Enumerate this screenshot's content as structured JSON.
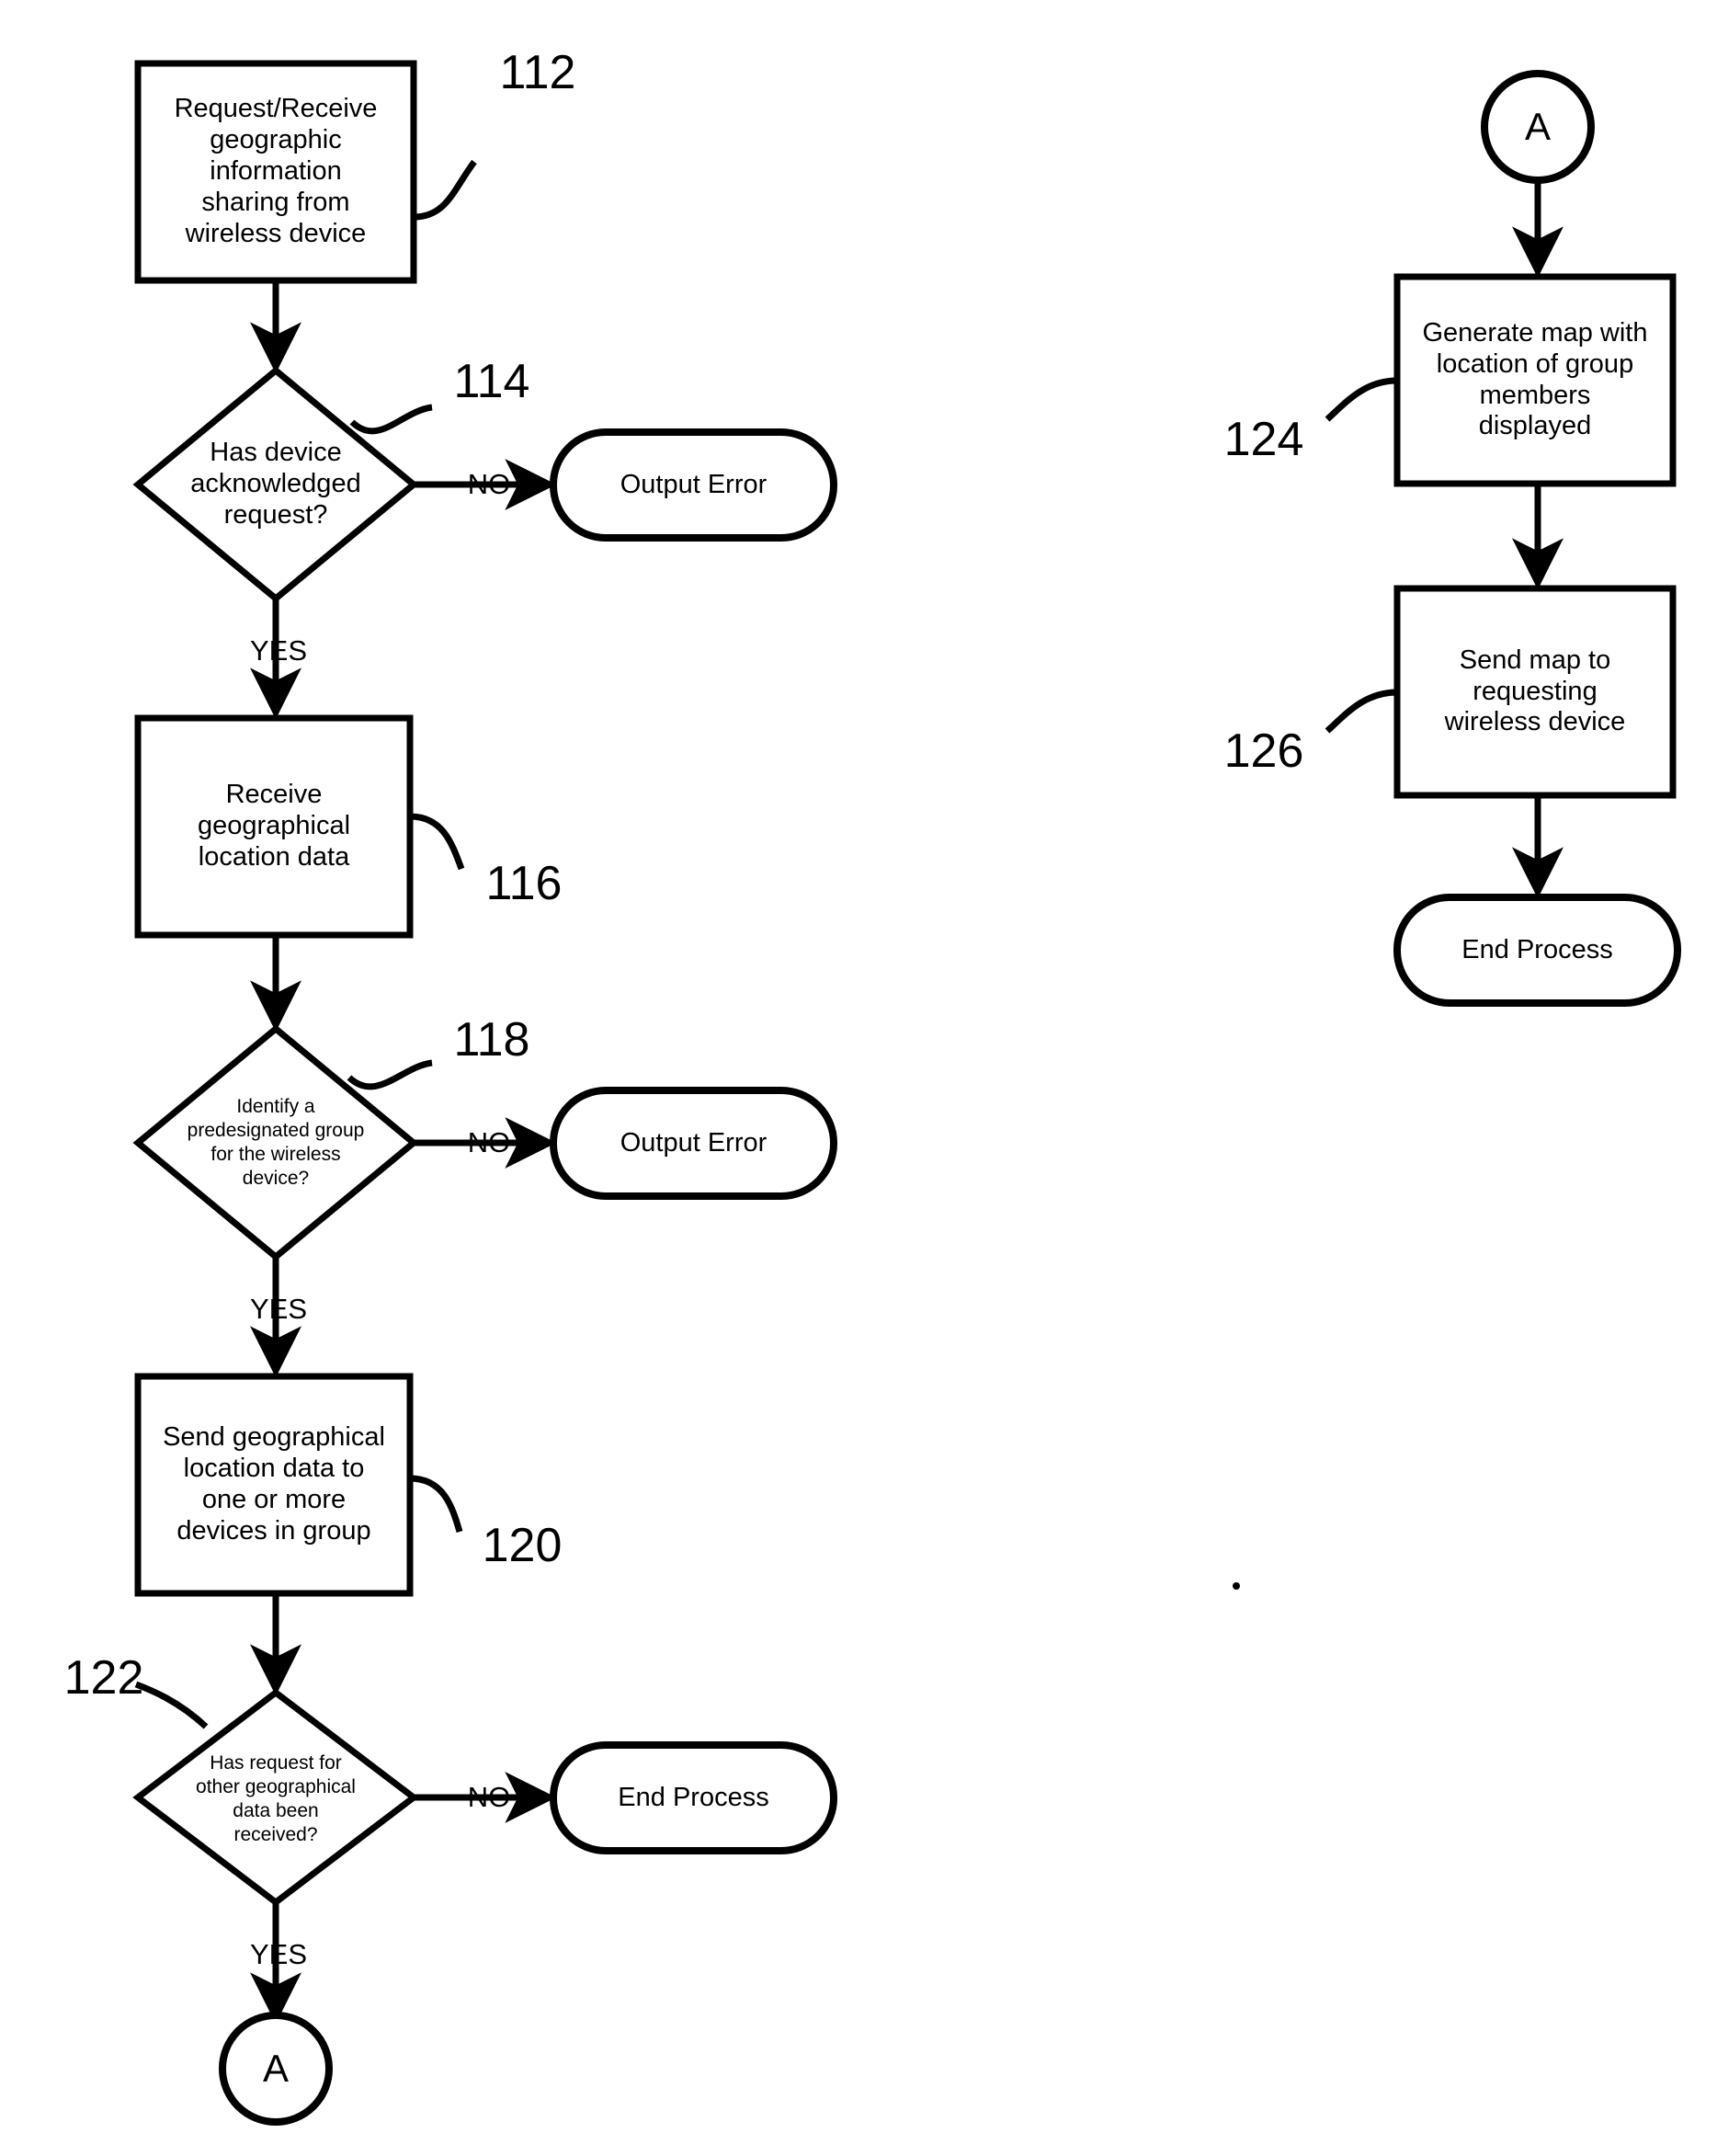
{
  "figure": {
    "type": "flowchart",
    "orientation": "two-column",
    "background_color": "#ffffff",
    "stroke_color": "#000000"
  },
  "nodes": {
    "n112": {
      "ref": "112",
      "shape": "process",
      "text": "Request/Receive\ngeographic\ninformation\nsharing from\nwireless device"
    },
    "n114": {
      "ref": "114",
      "shape": "decision",
      "text": "Has device\nacknowledged\nrequest?"
    },
    "n114_no": {
      "shape": "terminal",
      "text": "Output Error"
    },
    "n116": {
      "ref": "116",
      "shape": "process",
      "text": "Receive\ngeographical\nlocation data"
    },
    "n118": {
      "ref": "118",
      "shape": "decision",
      "text": "Identify a\npredesignated group\nfor the wireless\ndevice?"
    },
    "n118_no": {
      "shape": "terminal",
      "text": "Output Error"
    },
    "n120": {
      "ref": "120",
      "shape": "process",
      "text": "Send geographical\nlocation data to\none or more\ndevices in group"
    },
    "n122": {
      "ref": "122",
      "shape": "decision",
      "text": "Has request for\nother geographical\ndata been\nreceived?"
    },
    "n122_no": {
      "shape": "terminal",
      "text": "End Process"
    },
    "connector_a_bottom": {
      "shape": "connector",
      "text": "A"
    },
    "connector_a_top": {
      "shape": "connector",
      "text": "A"
    },
    "n124": {
      "ref": "124",
      "shape": "process",
      "text": "Generate map with\nlocation of group\nmembers\ndisplayed"
    },
    "n126": {
      "ref": "126",
      "shape": "process",
      "text": "Send map to\nrequesting\nwireless device"
    },
    "n_end_right": {
      "shape": "terminal",
      "text": "End Process"
    }
  },
  "branch_labels": {
    "yes_114": "YES",
    "no_114": "NO",
    "yes_118": "YES",
    "no_118": "NO",
    "yes_122": "YES",
    "no_122": "NO"
  },
  "reference_numerals": {
    "r112": "112",
    "r114": "114",
    "r116": "116",
    "r118": "118",
    "r120": "120",
    "r122": "122",
    "r124": "124",
    "r126": "126"
  }
}
